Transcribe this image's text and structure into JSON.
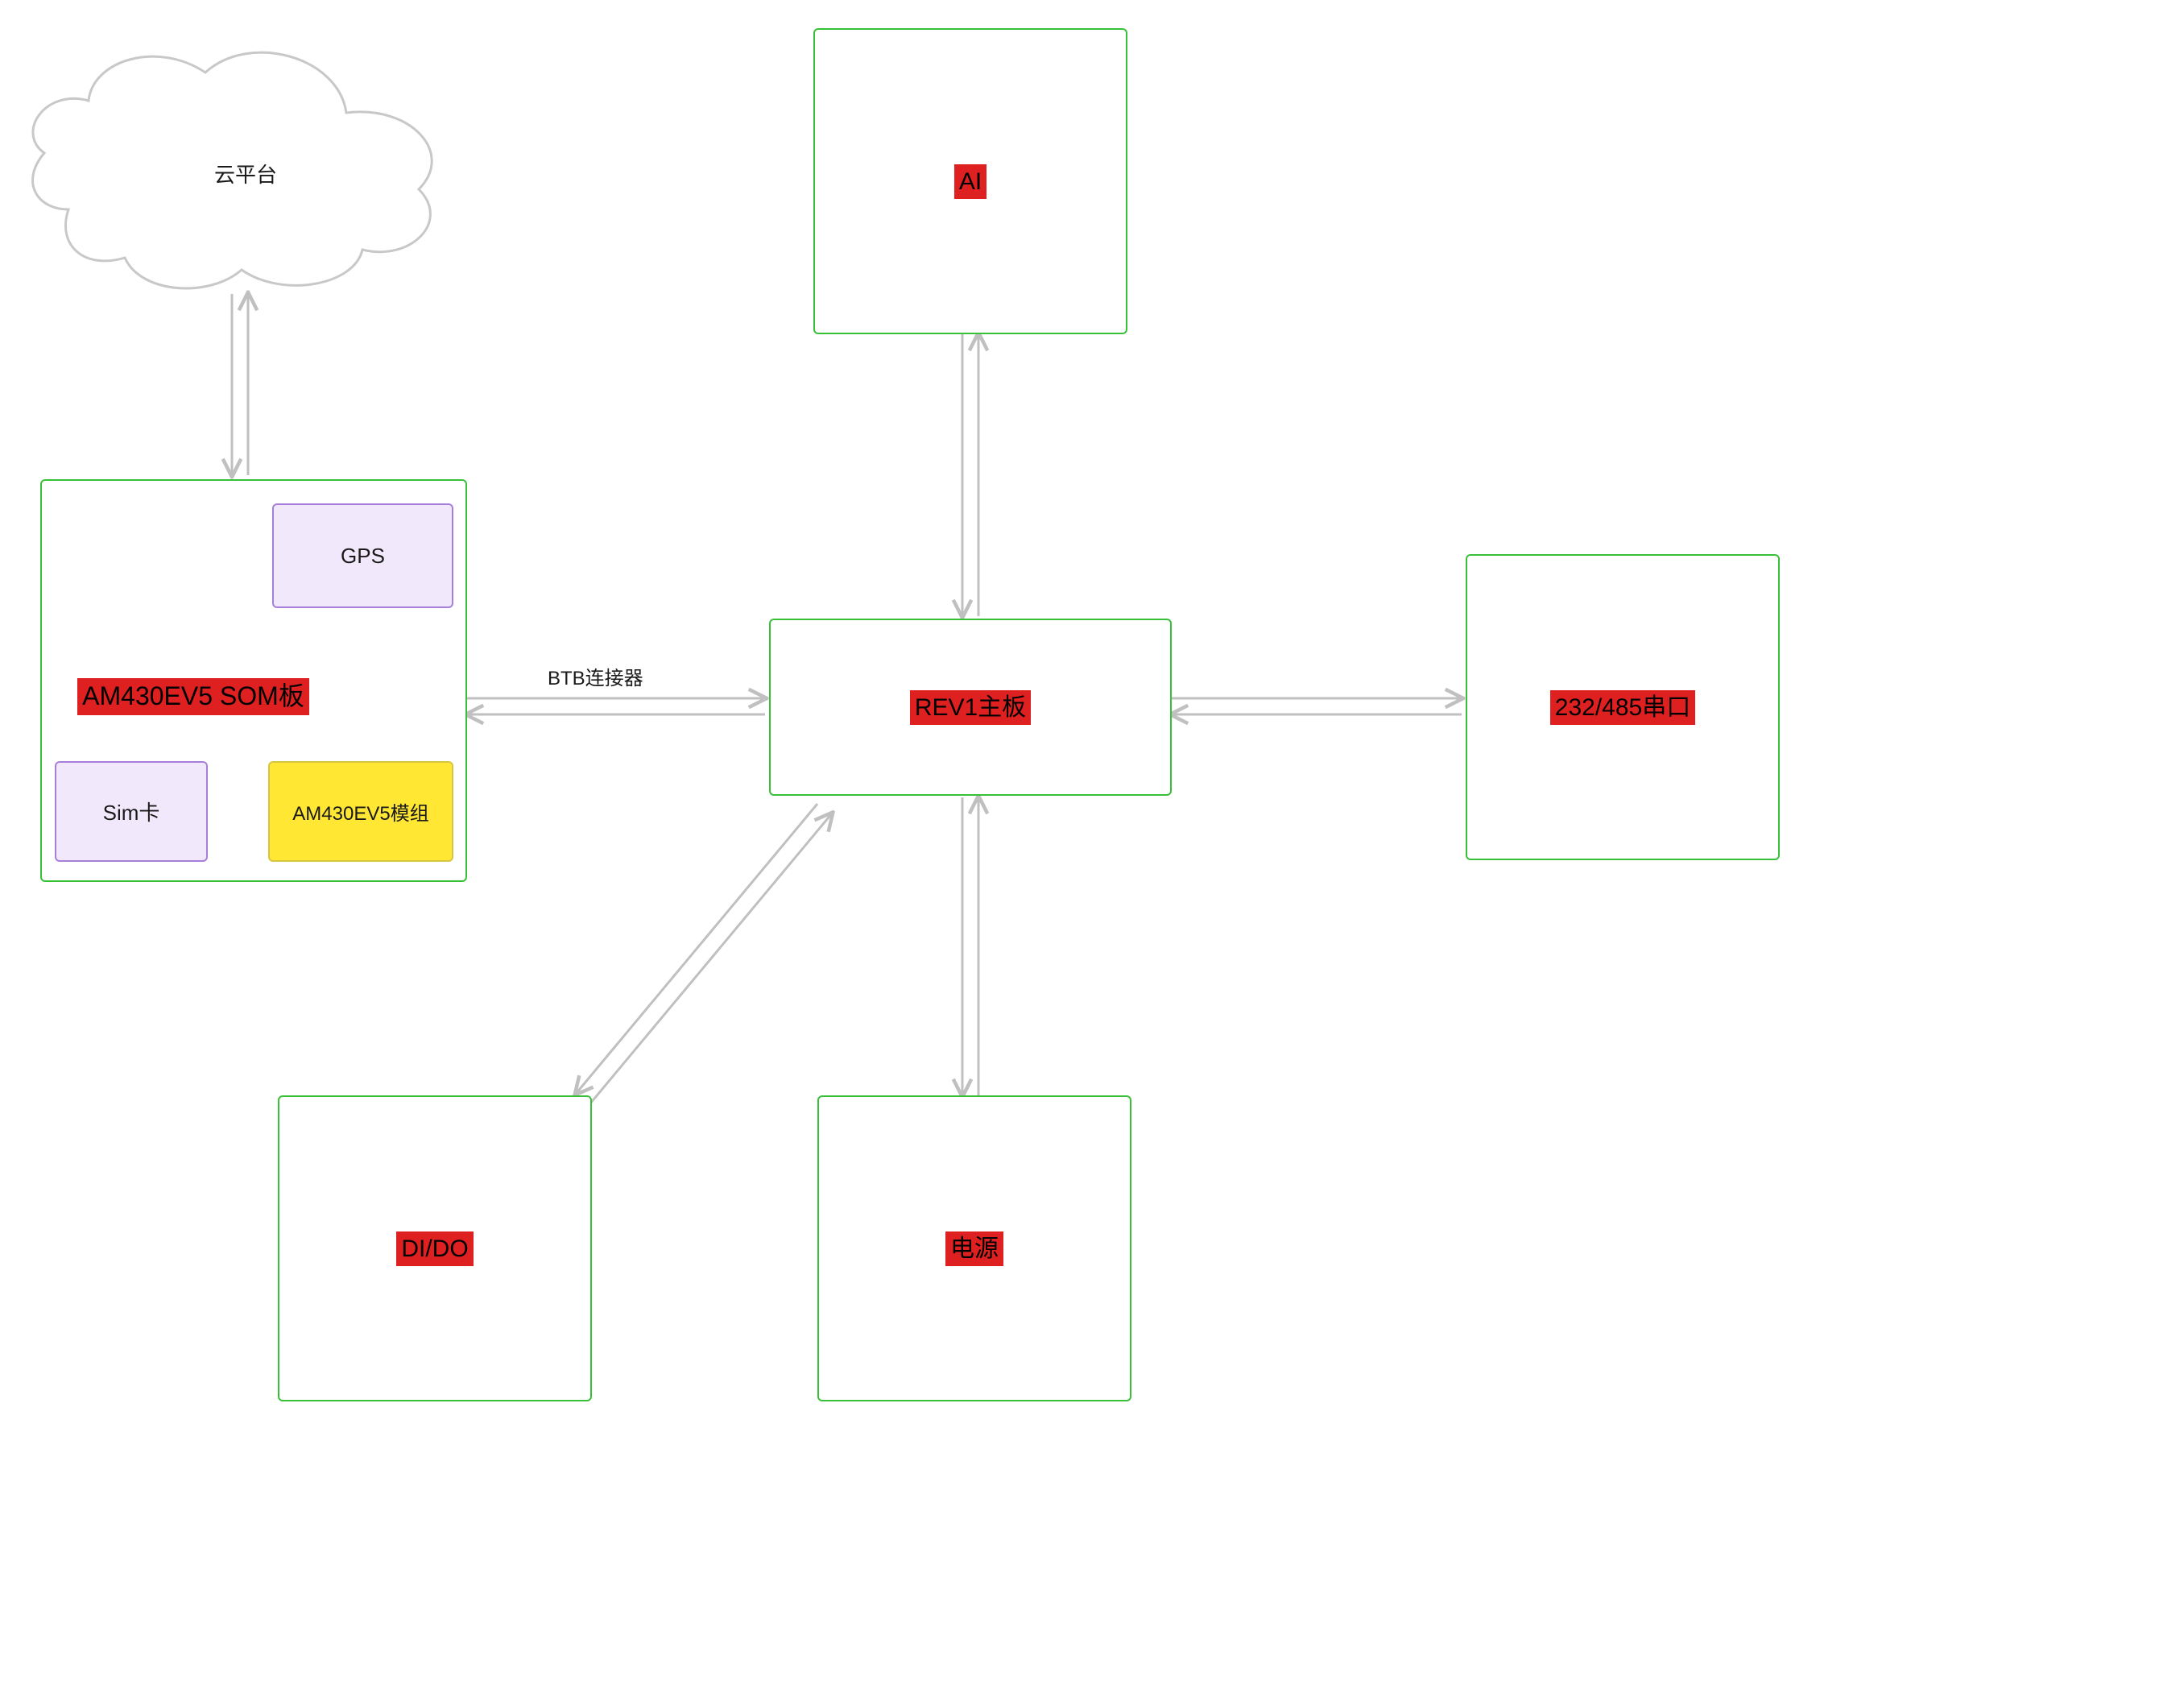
{
  "nodes": {
    "cloud": {
      "label": "云平台"
    },
    "som": {
      "label": "AM430EV5 SOM板"
    },
    "gps": {
      "label": "GPS"
    },
    "sim": {
      "label": "Sim卡"
    },
    "module": {
      "label": "AM430EV5模组"
    },
    "ai": {
      "label": "AI"
    },
    "rev1": {
      "label": "REV1主板"
    },
    "serial": {
      "label": "232/485串口"
    },
    "dido": {
      "label": "DI/DO"
    },
    "power": {
      "label": "电源"
    }
  },
  "edges": {
    "btb": {
      "label": "BTB连接器"
    }
  },
  "colors": {
    "green": "#38c138",
    "purple": "#a87fd8",
    "purple_fill": "#f1e9fb",
    "yellow": "#ffe733",
    "red": "#df2020",
    "arrow": "#c0c0c0",
    "cloud": "#c8c8c8"
  }
}
